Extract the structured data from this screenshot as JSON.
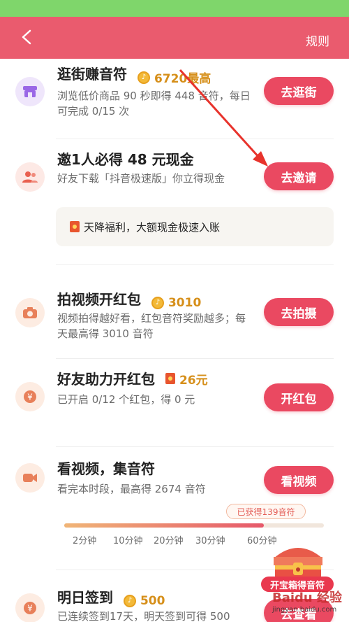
{
  "header": {
    "rule_label": "规则"
  },
  "tasks": [
    {
      "title": "逛街赚音符",
      "reward": "6720最高",
      "desc": "浏览低价商品 90 秒即得 448 音符，每日可完成 0/15 次",
      "button": "去逛街"
    },
    {
      "title": "邀1人必得 48 元现金",
      "desc": "好友下载「抖音极速版」你立得现金",
      "button": "去邀请",
      "promo": "天降福利，大额现金极速入账"
    },
    {
      "title": "拍视频开红包",
      "reward": "3010",
      "desc": "视频拍得越好看，红包音符奖励越多；每天最高得 3010 音符",
      "button": "去拍摄"
    },
    {
      "title": "好友助力开红包",
      "reward": "26元",
      "desc": "已开启 0/12 个红包，得 0 元",
      "button": "开红包"
    },
    {
      "title": "看视频，集音符",
      "desc": "看完本时段，最高得 2674 音符",
      "button": "看视频",
      "earned_badge": "已获得139音符",
      "progress_fraction": 0.77,
      "ticks": [
        "2分钟",
        "10分钟",
        "20分钟",
        "30分钟",
        "60分钟"
      ]
    },
    {
      "title": "明日签到",
      "reward": "500",
      "desc": "已连续签到17天，明天签到可得 500",
      "button": "去查看"
    }
  ],
  "chest": {
    "label": "开宝箱得音符"
  },
  "watermark": {
    "text": "Baidu 经验",
    "sub": "jingyan.baidu.com"
  },
  "colors": {
    "header": "#ea5b6e",
    "button": "#ea4961",
    "reward": "#d68f1a",
    "status_bar": "#7fd66b"
  },
  "icons": {
    "back": "chevron-left-icon",
    "shop": "store-icon",
    "invite": "users-icon",
    "camera": "camera-icon",
    "yen": "yen-icon",
    "video": "video-camera-icon",
    "coin": "music-note-coin-icon",
    "chest": "treasure-chest-icon"
  }
}
